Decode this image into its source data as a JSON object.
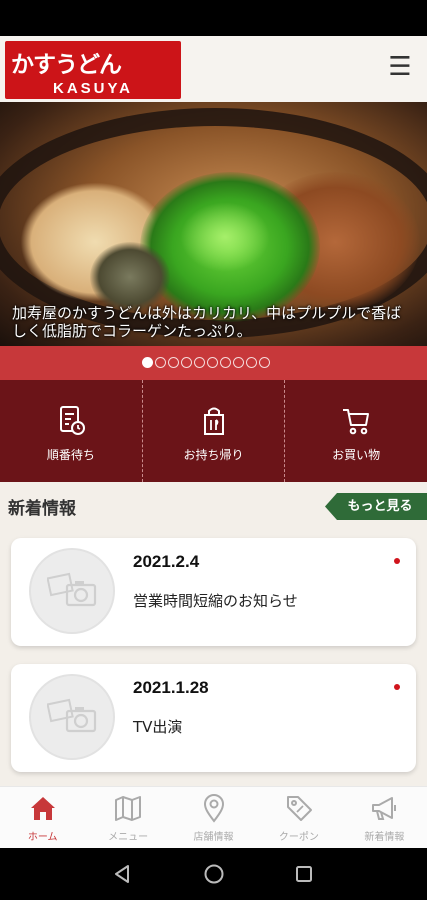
{
  "header": {
    "logo_text": "かすうどん",
    "logo_subtext": "KASUYA",
    "menu_icon": "hamburger-menu-icon"
  },
  "hero": {
    "caption": "加寿屋のかすうどんは外はカリカリ、中はプルプルで香ばしく低脂肪でコラーゲンたっぷり。",
    "slide_count": 10,
    "active_slide": 1
  },
  "quick_nav": [
    {
      "label": "順番待ち",
      "icon": "queue-ticket-icon"
    },
    {
      "label": "お持ち帰り",
      "icon": "takeout-bag-icon"
    },
    {
      "label": "お買い物",
      "icon": "shopping-cart-icon"
    }
  ],
  "news": {
    "section_title": "新着情報",
    "more_label": "もっと見る",
    "items": [
      {
        "date": "2021.2.4",
        "title": "営業時間短縮のお知らせ"
      },
      {
        "date": "2021.1.28",
        "title": "TV出演"
      }
    ]
  },
  "tabs": [
    {
      "label": "ホーム",
      "icon": "home-icon"
    },
    {
      "label": "メニュー",
      "icon": "menu-map-icon"
    },
    {
      "label": "店舗情報",
      "icon": "location-pin-icon"
    },
    {
      "label": "クーポン",
      "icon": "coupon-tag-icon"
    },
    {
      "label": "新着情報",
      "icon": "megaphone-icon"
    }
  ],
  "colors": {
    "brand_red": "#cc1418",
    "pager_red": "#c7383a",
    "quick_nav_bg": "#6b1418",
    "more_green": "#2f6b38"
  }
}
